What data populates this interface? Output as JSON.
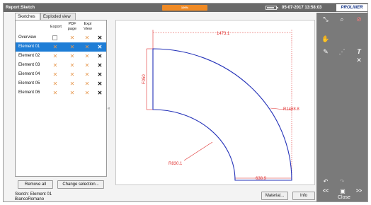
{
  "titlebar": {
    "title": "Report:Sketch",
    "progress_label": "100%",
    "datetime": "05-07-2017 13:58:03",
    "brand": "PROLINER",
    "accent_color": "#f08a24"
  },
  "tabs": [
    {
      "label": "Sketches",
      "active": true
    },
    {
      "label": "Exploded view",
      "active": false
    }
  ],
  "table": {
    "columns": [
      "Export",
      "PDF page",
      "Expl View"
    ],
    "rows": [
      {
        "name": "Overview",
        "selected": false
      },
      {
        "name": "Element 01",
        "selected": true
      },
      {
        "name": "Element 02",
        "selected": false
      },
      {
        "name": "Element 03",
        "selected": false
      },
      {
        "name": "Element 04",
        "selected": false
      },
      {
        "name": "Element 05",
        "selected": false
      },
      {
        "name": "Element 06",
        "selected": false
      }
    ]
  },
  "buttons": {
    "remove_all": "Remove all",
    "change_selection": "Change selection...",
    "material": "Material...",
    "info": "Info",
    "close": "Close"
  },
  "status": {
    "sketch": "Sketch: Element 01",
    "material": "BiancoRomano"
  },
  "collapse_icon": "«",
  "drawing": {
    "dim_top": "1473.1",
    "dim_left": "F050",
    "dim_outer_radius": "R1468.8",
    "dim_inner_radius": "R830.1",
    "dim_bottom": "638.9",
    "outline_color": "#2230b8",
    "dimension_color": "#e0302f"
  },
  "toolbar": {
    "icons": [
      "zoom-fit-icon",
      "magnifier-icon",
      "stop-icon",
      "hand-icon",
      "pencil-icon",
      "move-points-icon",
      "text-icon",
      "delete-icon",
      "undo-icon",
      "redo-icon",
      "previous-icon",
      "save-icon",
      "next-icon"
    ],
    "text_glyph": "T",
    "prev_glyph": "<<",
    "next_glyph": ">>"
  }
}
